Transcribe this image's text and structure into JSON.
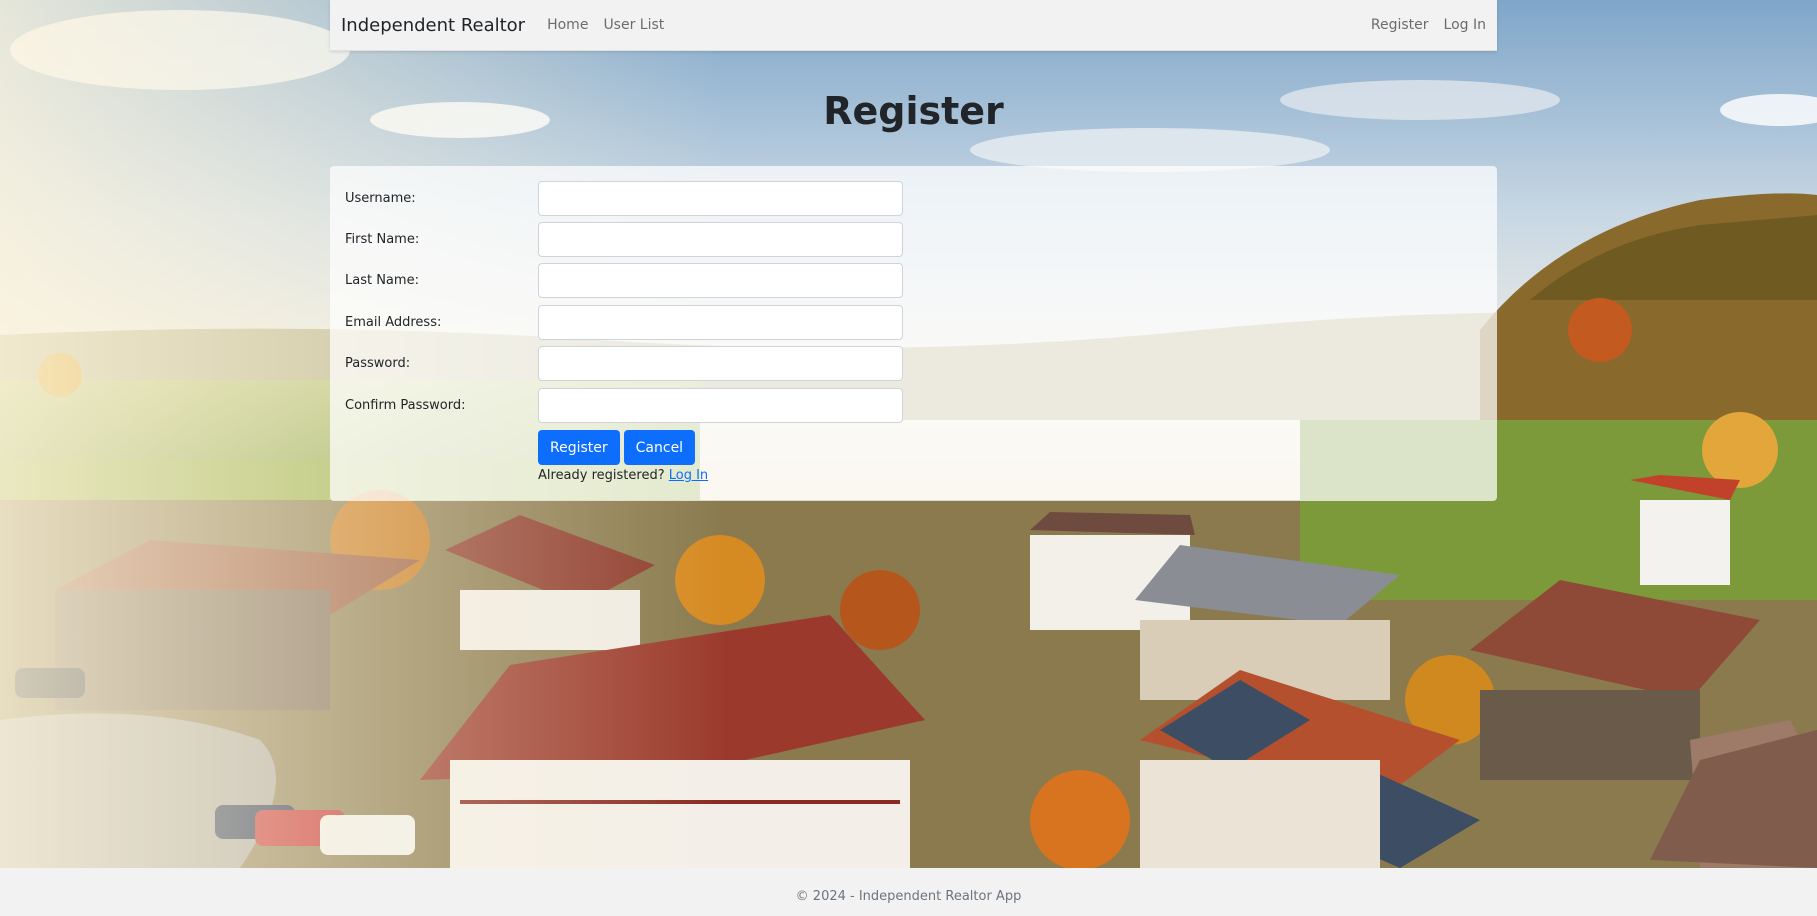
{
  "nav": {
    "brand": "Independent Realtor",
    "links": [
      {
        "label": "Home"
      },
      {
        "label": "User List"
      }
    ],
    "right_links": [
      {
        "label": "Register"
      },
      {
        "label": "Log In"
      }
    ]
  },
  "page": {
    "title": "Register"
  },
  "form": {
    "fields": [
      {
        "label": "Username:",
        "value": ""
      },
      {
        "label": "First Name:",
        "value": ""
      },
      {
        "label": "Last Name:",
        "value": ""
      },
      {
        "label": "Email Address:",
        "value": ""
      },
      {
        "label": "Password:",
        "value": ""
      },
      {
        "label": "Confirm Password:",
        "value": ""
      }
    ],
    "register_label": "Register",
    "cancel_label": "Cancel",
    "already_text": "Already registered?",
    "login_link": "Log In"
  },
  "footer": {
    "text": "© 2024 - Independent Realtor App"
  },
  "colors": {
    "primary": "#0d6efd",
    "navbar_bg": "#f2f2f2"
  }
}
